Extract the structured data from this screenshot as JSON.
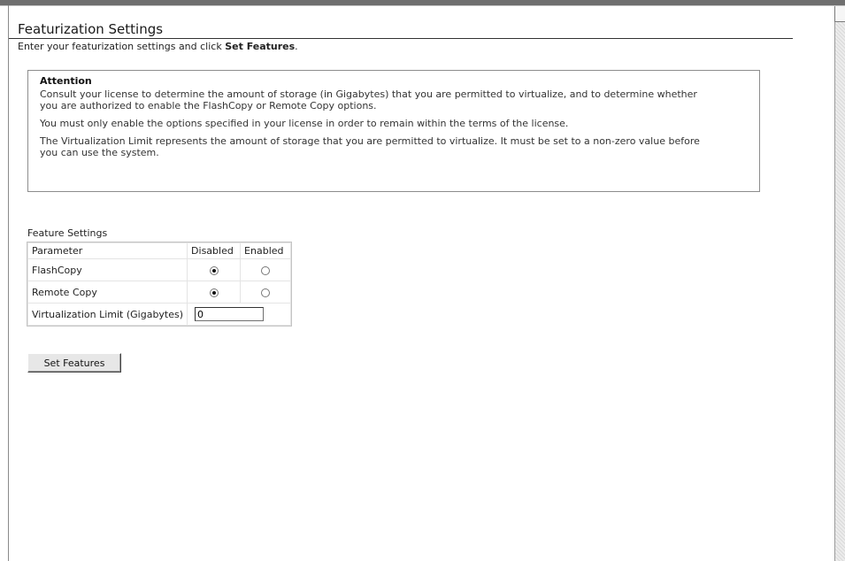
{
  "page": {
    "title": "Featurization Settings",
    "instructions_prefix": "Enter your featurization settings and click ",
    "instructions_action": "Set Features",
    "instructions_suffix": "."
  },
  "attention": {
    "title": "Attention",
    "paragraphs": [
      "Consult your license to determine the amount of storage (in Gigabytes) that you are permitted to virtualize, and to determine whether you are authorized to enable the FlashCopy or Remote Copy options.",
      "You must only enable the options specified in your license in order to remain within the terms of the license.",
      "The Virtualization Limit represents the amount of storage that you are permitted to virtualize. It must be set to a non-zero value before you can use the system."
    ]
  },
  "features": {
    "section_label": "Feature Settings",
    "headers": {
      "parameter": "Parameter",
      "disabled": "Disabled",
      "enabled": "Enabled"
    },
    "rows": [
      {
        "label": "FlashCopy",
        "selected": "disabled"
      },
      {
        "label": "Remote Copy",
        "selected": "disabled"
      }
    ],
    "limit": {
      "label": "Virtualization Limit (Gigabytes)",
      "value": "0"
    }
  },
  "actions": {
    "set_features_label": "Set Features"
  }
}
